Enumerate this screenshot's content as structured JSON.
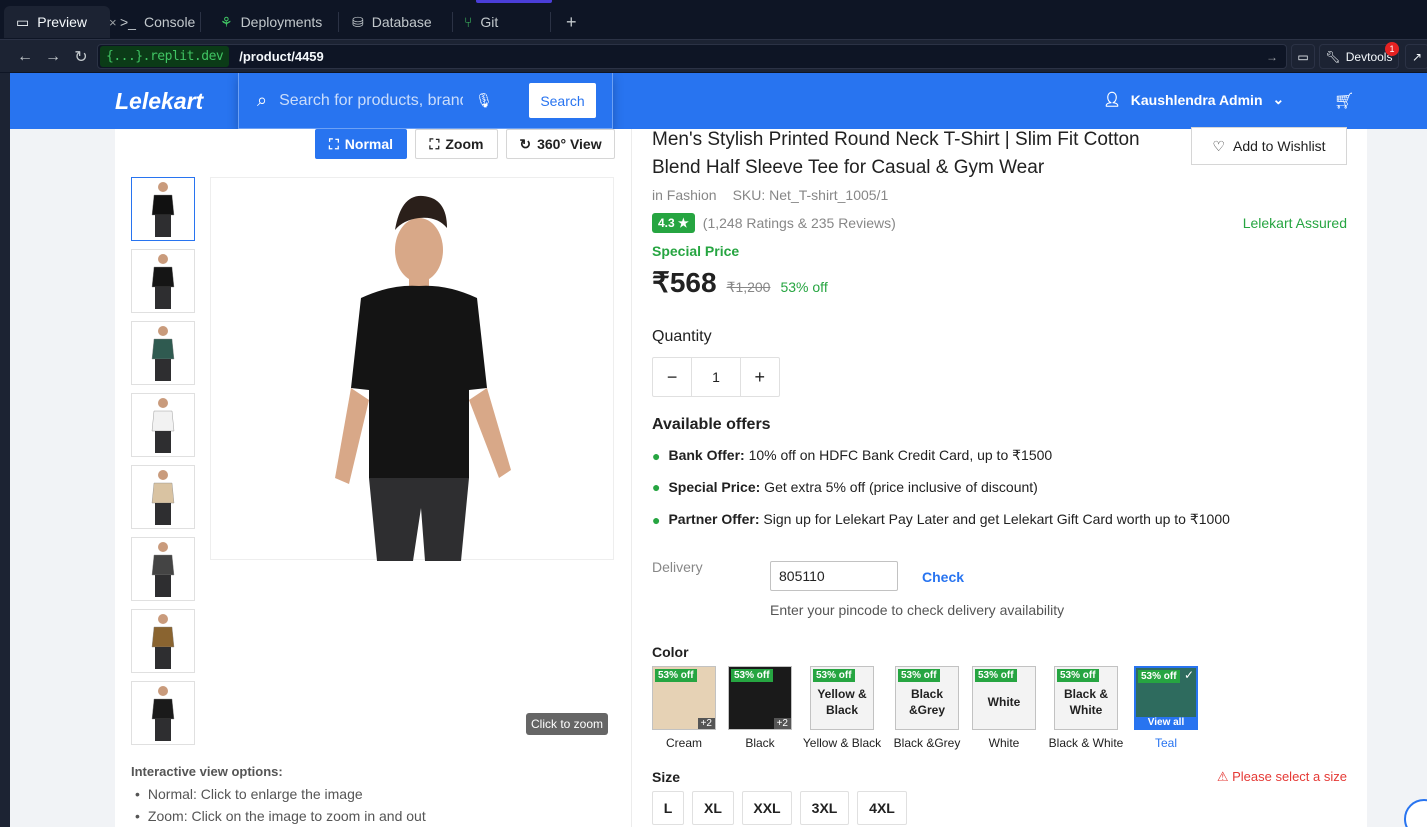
{
  "chrome": {
    "tabs": [
      {
        "label": "Preview",
        "icon": "monitor-icon"
      },
      {
        "label": "Console",
        "icon": "terminal-icon"
      },
      {
        "label": "Deployments",
        "icon": "deploy-icon"
      },
      {
        "label": "Database",
        "icon": "database-icon"
      },
      {
        "label": "Git",
        "icon": "git-icon"
      }
    ],
    "url_host": "{...}.replit.dev",
    "url_path": "/product/4459",
    "devtools_label": "Devtools",
    "devtools_badge": "1"
  },
  "header": {
    "logo": "Lelekart",
    "search_placeholder": "Search for products, brands and more",
    "search_button": "Search",
    "user_name": "Kaushlendra Admin"
  },
  "gallery": {
    "view_modes": [
      "Normal",
      "Zoom",
      "360° View"
    ],
    "thumb_colors": [
      "#111111",
      "#151515",
      "#2f5a50",
      "#f2f2f2",
      "#d9c3a2",
      "#444444",
      "#8a6430",
      "#1a1a1a"
    ],
    "zoom_tip": "Click to zoom",
    "options_title": "Interactive view options:",
    "options": [
      "Normal: Click to enlarge the image",
      "Zoom: Click on the image to zoom in and out"
    ]
  },
  "product": {
    "title": "Men's Stylish Printed Round Neck T-Shirt | Slim Fit Cotton Blend Half Sleeve Tee for Casual & Gym Wear",
    "wishlist_label": "Add to Wishlist",
    "category": "in Fashion",
    "sku": "SKU: Net_T-shirt_1005/1",
    "rating": "4.3 ★",
    "rating_count": "(1,248 Ratings & 235 Reviews)",
    "assured": "Lelekart Assured",
    "special_label": "Special Price",
    "price": "₹568",
    "mrp": "₹1,200",
    "discount": "53% off",
    "quantity_label": "Quantity",
    "quantity": "1",
    "offers_title": "Available offers",
    "offers": [
      {
        "bold": "Bank Offer:",
        "text": " 10% off on HDFC Bank Credit Card, up to ₹1500"
      },
      {
        "bold": "Special Price:",
        "text": " Get extra 5% off (price inclusive of discount)"
      },
      {
        "bold": "Partner Offer:",
        "text": " Sign up for Lelekart Pay Later and get Lelekart Gift Card worth up to ₹1000"
      }
    ],
    "delivery_label": "Delivery",
    "pincode": "805110",
    "check_label": "Check",
    "pincode_help": "Enter your pincode to check delivery availability",
    "color_label": "Color",
    "colors": [
      {
        "name": "Cream",
        "badge": "53% off",
        "box_text": "",
        "extra": "+2",
        "swatch": "#e6d2b5"
      },
      {
        "name": "Black",
        "badge": "53% off",
        "box_text": "",
        "extra": "+2",
        "swatch": "#1a1a1a"
      },
      {
        "name": "Yellow & Black",
        "badge": "53% off",
        "box_text": "Yellow & Black",
        "extra": "",
        "swatch": ""
      },
      {
        "name": "Black &Grey",
        "badge": "53% off",
        "box_text": "Black &Grey",
        "extra": "",
        "swatch": ""
      },
      {
        "name": "White",
        "badge": "53% off",
        "box_text": "White",
        "extra": "",
        "swatch": ""
      },
      {
        "name": "Black & White",
        "badge": "53% off",
        "box_text": "Black & White",
        "extra": "",
        "swatch": ""
      },
      {
        "name": "Teal",
        "badge": "53% off",
        "box_text": "",
        "extra": "View all",
        "swatch": "#2e6b5e"
      }
    ],
    "size_label": "Size",
    "size_error": "Please select a size",
    "sizes": [
      "L",
      "XL",
      "XXL",
      "3XL",
      "4XL"
    ]
  }
}
